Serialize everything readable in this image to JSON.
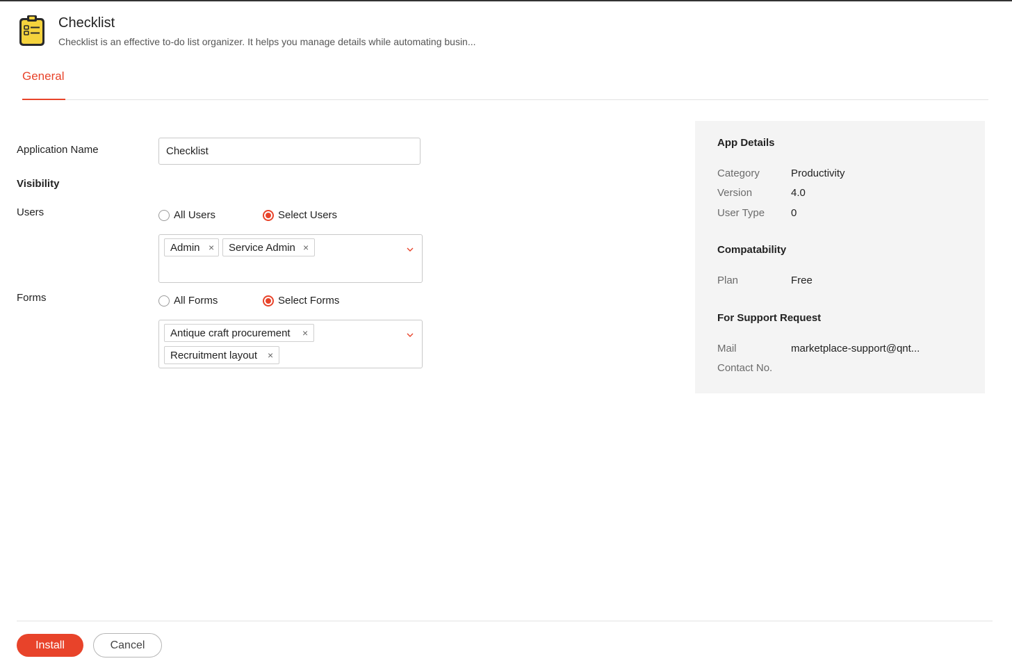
{
  "header": {
    "title": "Checklist",
    "description": "Checklist is an effective to-do list organizer. It helps you manage details while automating busin...",
    "icon": "clipboard-checklist-icon"
  },
  "tabs": [
    {
      "label": "General",
      "active": true
    }
  ],
  "form": {
    "app_name_label": "Application Name",
    "app_name_value": "Checklist",
    "visibility_heading": "Visibility",
    "users": {
      "label": "Users",
      "option_all": "All Users",
      "option_select": "Select Users",
      "selected_option": "Select Users",
      "chips": [
        "Admin",
        "Service Admin"
      ]
    },
    "forms": {
      "label": "Forms",
      "option_all": "All Forms",
      "option_select": "Select Forms",
      "selected_option": "Select Forms",
      "chips": [
        "Antique craft procurement",
        "Recruitment layout"
      ]
    }
  },
  "app_details": {
    "heading": "App Details",
    "category_label": "Category",
    "category_value": "Productivity",
    "version_label": "Version",
    "version_value": "4.0",
    "user_type_label": "User Type",
    "user_type_value": "0",
    "compat_heading": "Compatability",
    "plan_label": "Plan",
    "plan_value": "Free",
    "support_heading": "For Support Request",
    "mail_label": "Mail",
    "mail_value": "marketplace-support@qnt...",
    "contact_label": "Contact No."
  },
  "footer": {
    "install_label": "Install",
    "cancel_label": "Cancel"
  },
  "colors": {
    "accent": "#e8432a",
    "panel_bg": "#f4f4f4",
    "icon_yellow": "#f5d33d"
  }
}
